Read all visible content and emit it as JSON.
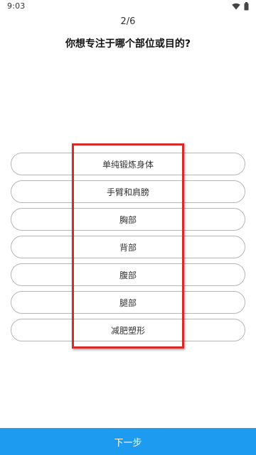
{
  "status_bar": {
    "time": "9:03",
    "icons": [
      "wifi-icon",
      "battery-icon"
    ]
  },
  "header": {
    "progress": "2/6",
    "question": "你想专注于哪个部位或目的?"
  },
  "options": [
    {
      "label": "单纯锻炼身体"
    },
    {
      "label": "手臂和肩膀"
    },
    {
      "label": "胸部"
    },
    {
      "label": "背部"
    },
    {
      "label": "腹部"
    },
    {
      "label": "腿部"
    },
    {
      "label": "减肥塑形"
    }
  ],
  "footer": {
    "next_label": "下一步"
  },
  "colors": {
    "primary": "#1d9bf0",
    "highlight": "#d52b2b",
    "option_border": "#b5b5b5"
  }
}
